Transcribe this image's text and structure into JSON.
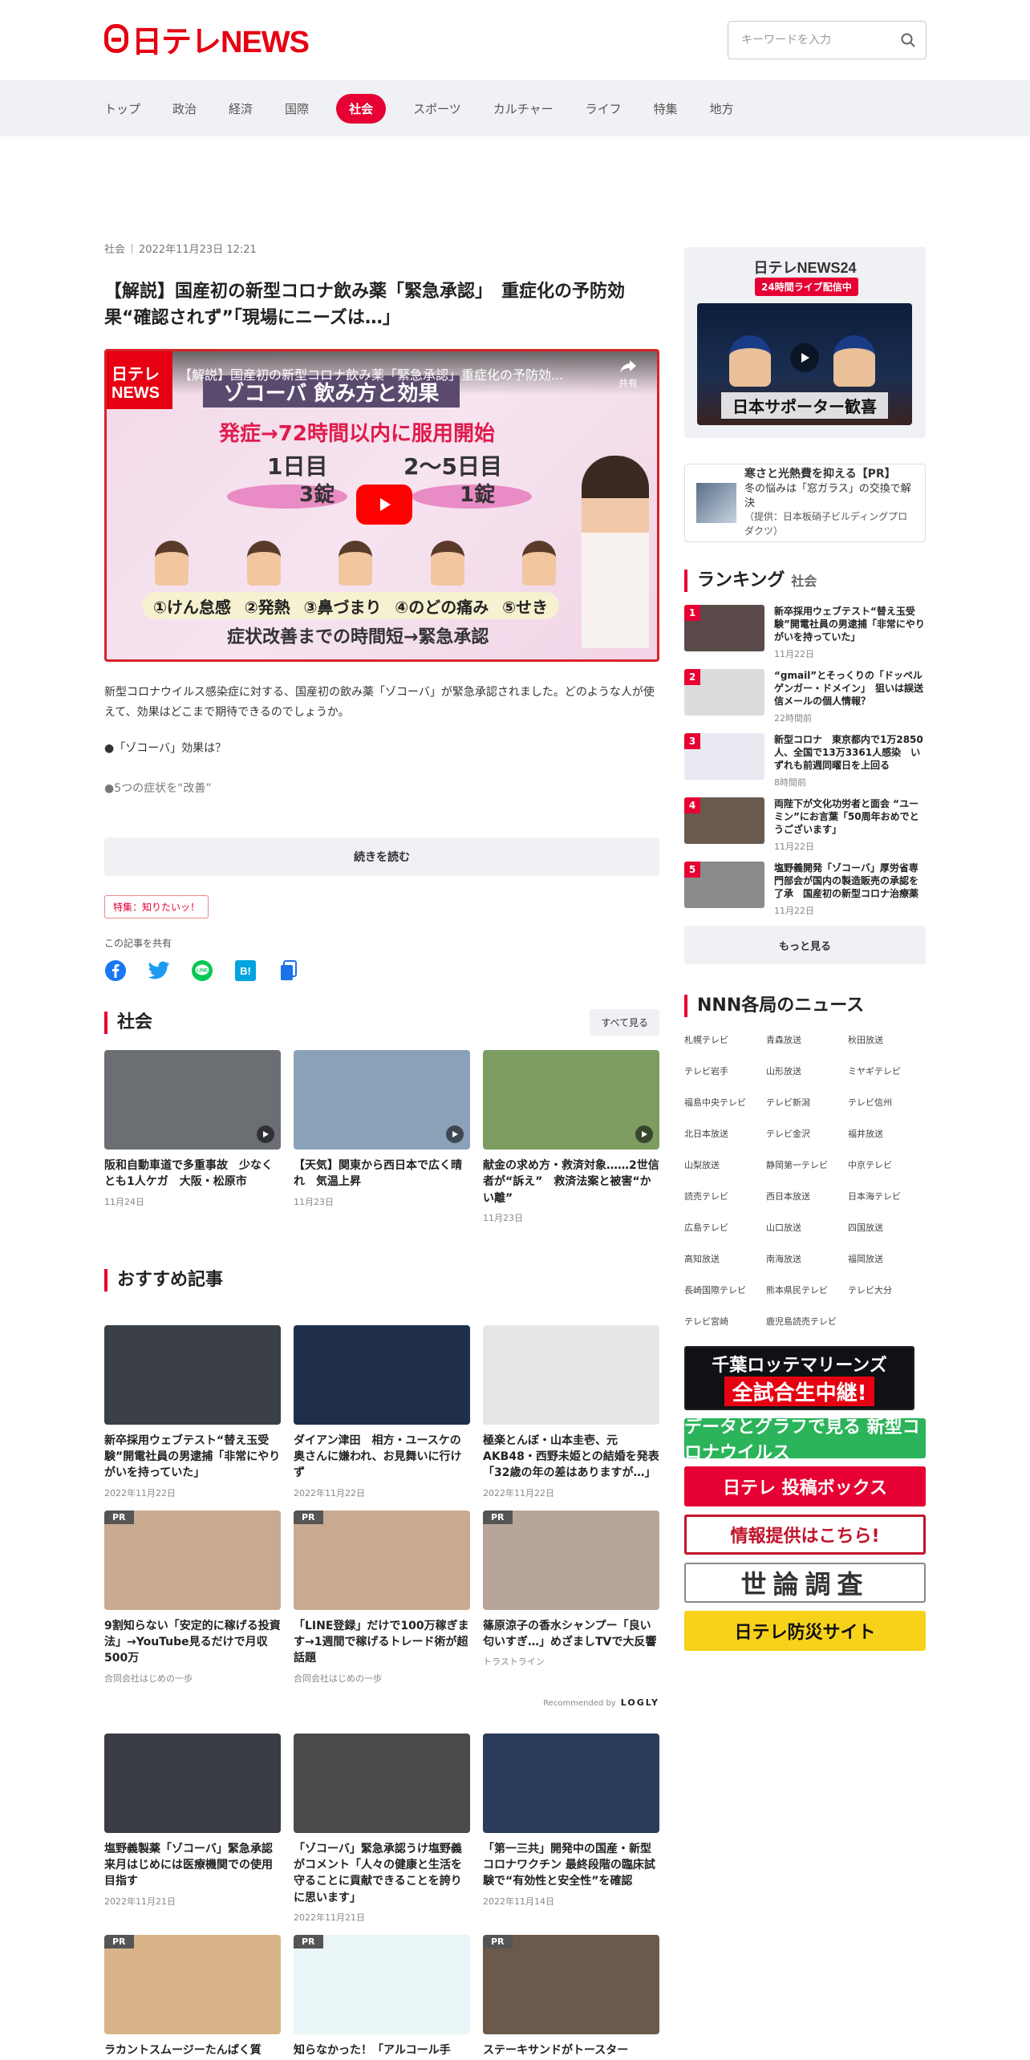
{
  "header": {
    "logo": "日テレNEWS",
    "search_placeholder": "キーワードを入力"
  },
  "nav": {
    "items": [
      "トップ",
      "政治",
      "経済",
      "国際",
      "社会",
      "スポーツ",
      "カルチャー",
      "ライフ",
      "特集",
      "地方"
    ],
    "active_index": 4
  },
  "article": {
    "category": "社会",
    "date": "2022年11月23日 12:21",
    "title": "【解説】国産初の新型コロナ飲み薬「緊急承認」　重症化の予防効果“確認されず”「現場にニーズは…」",
    "video": {
      "title": "【解説】国産初の新型コロナ飲み薬「緊急承認」重症化の予防効...",
      "share": "共有",
      "logo_text": "日テレ NEWS",
      "banner": "ゾコーバ 飲み方と効果",
      "rule": "発症→72時間以内に服用開始",
      "day1": "1日目",
      "day2": "2〜5日目",
      "dose1": "3錠",
      "dose2": "1錠",
      "symptoms": [
        "①けん怠感",
        "②発熱",
        "③鼻づまり",
        "④のどの痛み",
        "⑤せき"
      ],
      "caption": "症状改善までの時間短→緊急承認"
    },
    "lead": "新型コロナウイルス感染症に対する、国産初の飲み薬「ゾコーバ」が緊急承認されました。どのような人が使えて、効果はどこまで期待できるのでしょうか。",
    "point1": "●「ゾコーバ」効果は？",
    "point2": "●5つの症状を“改善”",
    "read_more": "続きを読む",
    "tag": "特集：知りたいッ！",
    "share_label": "この記事を共有"
  },
  "society": {
    "title": "社会",
    "more": "すべて見る",
    "cards": [
      {
        "title": "阪和自動車道で多重事故　少なくとも1人ケガ　大阪・松原市",
        "date": "11月24日",
        "thumb_color": "#6b6e73"
      },
      {
        "title": "【天気】関東から西日本で広く晴れ　気温上昇",
        "date": "11月23日",
        "thumb_color": "#8aa1b8"
      },
      {
        "title": "献金の求め方・救済対象……2世信者が“訴え”　救済法案と被害“かい離”",
        "date": "11月23日",
        "thumb_color": "#7d9c61"
      }
    ]
  },
  "recommended": {
    "title": "おすすめ記事",
    "row1": [
      {
        "title": "新卒採用ウェブテスト“替え玉受験”開電社員の男逮捕「非常にやりがいを持っていた」",
        "date": "2022年11月22日",
        "pr": "",
        "thumb_color": "#3b3f48"
      },
      {
        "title": "ダイアン津田　相方・ユースケの奥さんに嫌われ、お見舞いに行けず",
        "date": "2022年11月22日",
        "pr": "",
        "thumb_color": "#1f2f4a"
      },
      {
        "title": "極楽とんぼ・山本圭壱、元AKB48・西野未姫との結婚を発表「32歳の年の差はありますが…」",
        "date": "2022年11月22日",
        "pr": "",
        "thumb_color": "#e8e6e4"
      }
    ],
    "row2": [
      {
        "title": "9割知らない「安定的に稼げる投資法」→YouTube見るだけで月収500万",
        "date": "合同会社はじめの一歩",
        "pr": "PR",
        "thumb_color": "#c9a98f"
      },
      {
        "title": "「LINE登録」だけで100万稼ぎます→1週間で稼げるトレード術が超話題",
        "date": "合同会社はじめの一歩",
        "pr": "PR",
        "thumb_color": "#c9a98f"
      },
      {
        "title": "篠原涼子の香水シャンプー「良い匂いすぎ…」めざましTVで大反響",
        "date": "トラストライン",
        "pr": "PR",
        "thumb_color": "#b8a59a"
      }
    ],
    "recommended_by": "Recommended by",
    "logly": "LOGLY",
    "row3": [
      {
        "title": "塩野義製薬「ゾコーバ」緊急承認　来月はじめには医療機関での使用目指す",
        "date": "2022年11月21日",
        "pr": "",
        "thumb_color": "#3a3d44"
      },
      {
        "title": "「ゾコーバ」緊急承認うけ塩野義がコメント「人々の健康と生活を守ることに貢献できることを誇りに思います」",
        "date": "2022年11月21日",
        "pr": "",
        "thumb_color": "#4a4a4a"
      },
      {
        "title": "「第一三共」開発中の国産・新型コロナワクチン 最終段階の臨床試験で“有効性と安全性”を確認",
        "date": "2022年11月14日",
        "pr": "",
        "thumb_color": "#2b3c5a"
      }
    ],
    "row4": [
      {
        "title": "ラカントスムージーたんぱく質",
        "date": "",
        "pr": "PR",
        "thumb_color": "#d9b48a"
      },
      {
        "title": "知らなかった！「アルコール手",
        "date": "",
        "pr": "PR",
        "thumb_color": "#e9f5f6"
      },
      {
        "title": "ステーキサンドがトースター",
        "date": "",
        "pr": "PR",
        "thumb_color": "#6b5a4b"
      }
    ]
  },
  "sidebar": {
    "live": {
      "brand": "日テレNEWS24",
      "badge": "24時間ライブ配信中",
      "caption": "日本サポーター歓喜"
    },
    "ad": {
      "title": "寒さと光熱費を抑える【PR】",
      "body": "冬の悩みは「窓ガラス」の交換で解決",
      "source": "（提供：日本板硝子ビルディングプロダクツ）"
    },
    "ranking": {
      "title": "ランキング",
      "sub": "社会",
      "items": [
        {
          "num": "1",
          "title": "新卒採用ウェブテスト“替え玉受験”開電社員の男逮捕「非常にやりがいを持っていた」",
          "date": "11月22日",
          "thumb_color": "#5a4a4a"
        },
        {
          "num": "2",
          "title": "“gmail”とそっくりの「ドッペルゲンガー・ドメイン」　狙いは誤送信メールの個人情報？",
          "date": "22時間前",
          "thumb_color": "#dcdcdc"
        },
        {
          "num": "3",
          "title": "新型コロナ　東京都内で1万2850人、全国で13万3361人感染　いずれも前週同曜日を上回る",
          "date": "8時間前",
          "thumb_color": "#e9e9f2"
        },
        {
          "num": "4",
          "title": "両陛下が文化功労者と面会 “ユーミン”にお言葉「50周年おめでとうございます」",
          "date": "11月22日",
          "thumb_color": "#6a5a4e"
        },
        {
          "num": "5",
          "title": "塩野義開発「ゾコーバ」厚労省専門部会が国内の製造販売の承認を了承　国産初の新型コロナ治療薬",
          "date": "11月22日",
          "thumb_color": "#8a8a8a"
        }
      ],
      "more": "もっと見る"
    },
    "nnn": {
      "title": "NNN各局のニュース",
      "stations": [
        "札幌テレビ",
        "青森放送",
        "秋田放送",
        "テレビ岩手",
        "山形放送",
        "ミヤギテレビ",
        "福島中央テレビ",
        "テレビ新潟",
        "テレビ信州",
        "北日本放送",
        "テレビ金沢",
        "福井放送",
        "山梨放送",
        "静岡第一テレビ",
        "中京テレビ",
        "読売テレビ",
        "西日本放送",
        "日本海テレビ",
        "広島テレビ",
        "山口放送",
        "四国放送",
        "高知放送",
        "南海放送",
        "福岡放送",
        "長崎国際テレビ",
        "熊本県民テレビ",
        "テレビ大分",
        "テレビ宮崎",
        "鹿児島読売テレビ"
      ]
    },
    "banners": {
      "b1_top": "千葉ロッテマリーンズ",
      "b1_main": "全試合生中継!",
      "b2": "データとグラフで見る 新型コロナウイルス",
      "b3": "日テレ 投稿ボックス",
      "b4": "情報提供はこちら!",
      "b5": "世論調査",
      "b6": "日テレ防災サイト"
    }
  }
}
